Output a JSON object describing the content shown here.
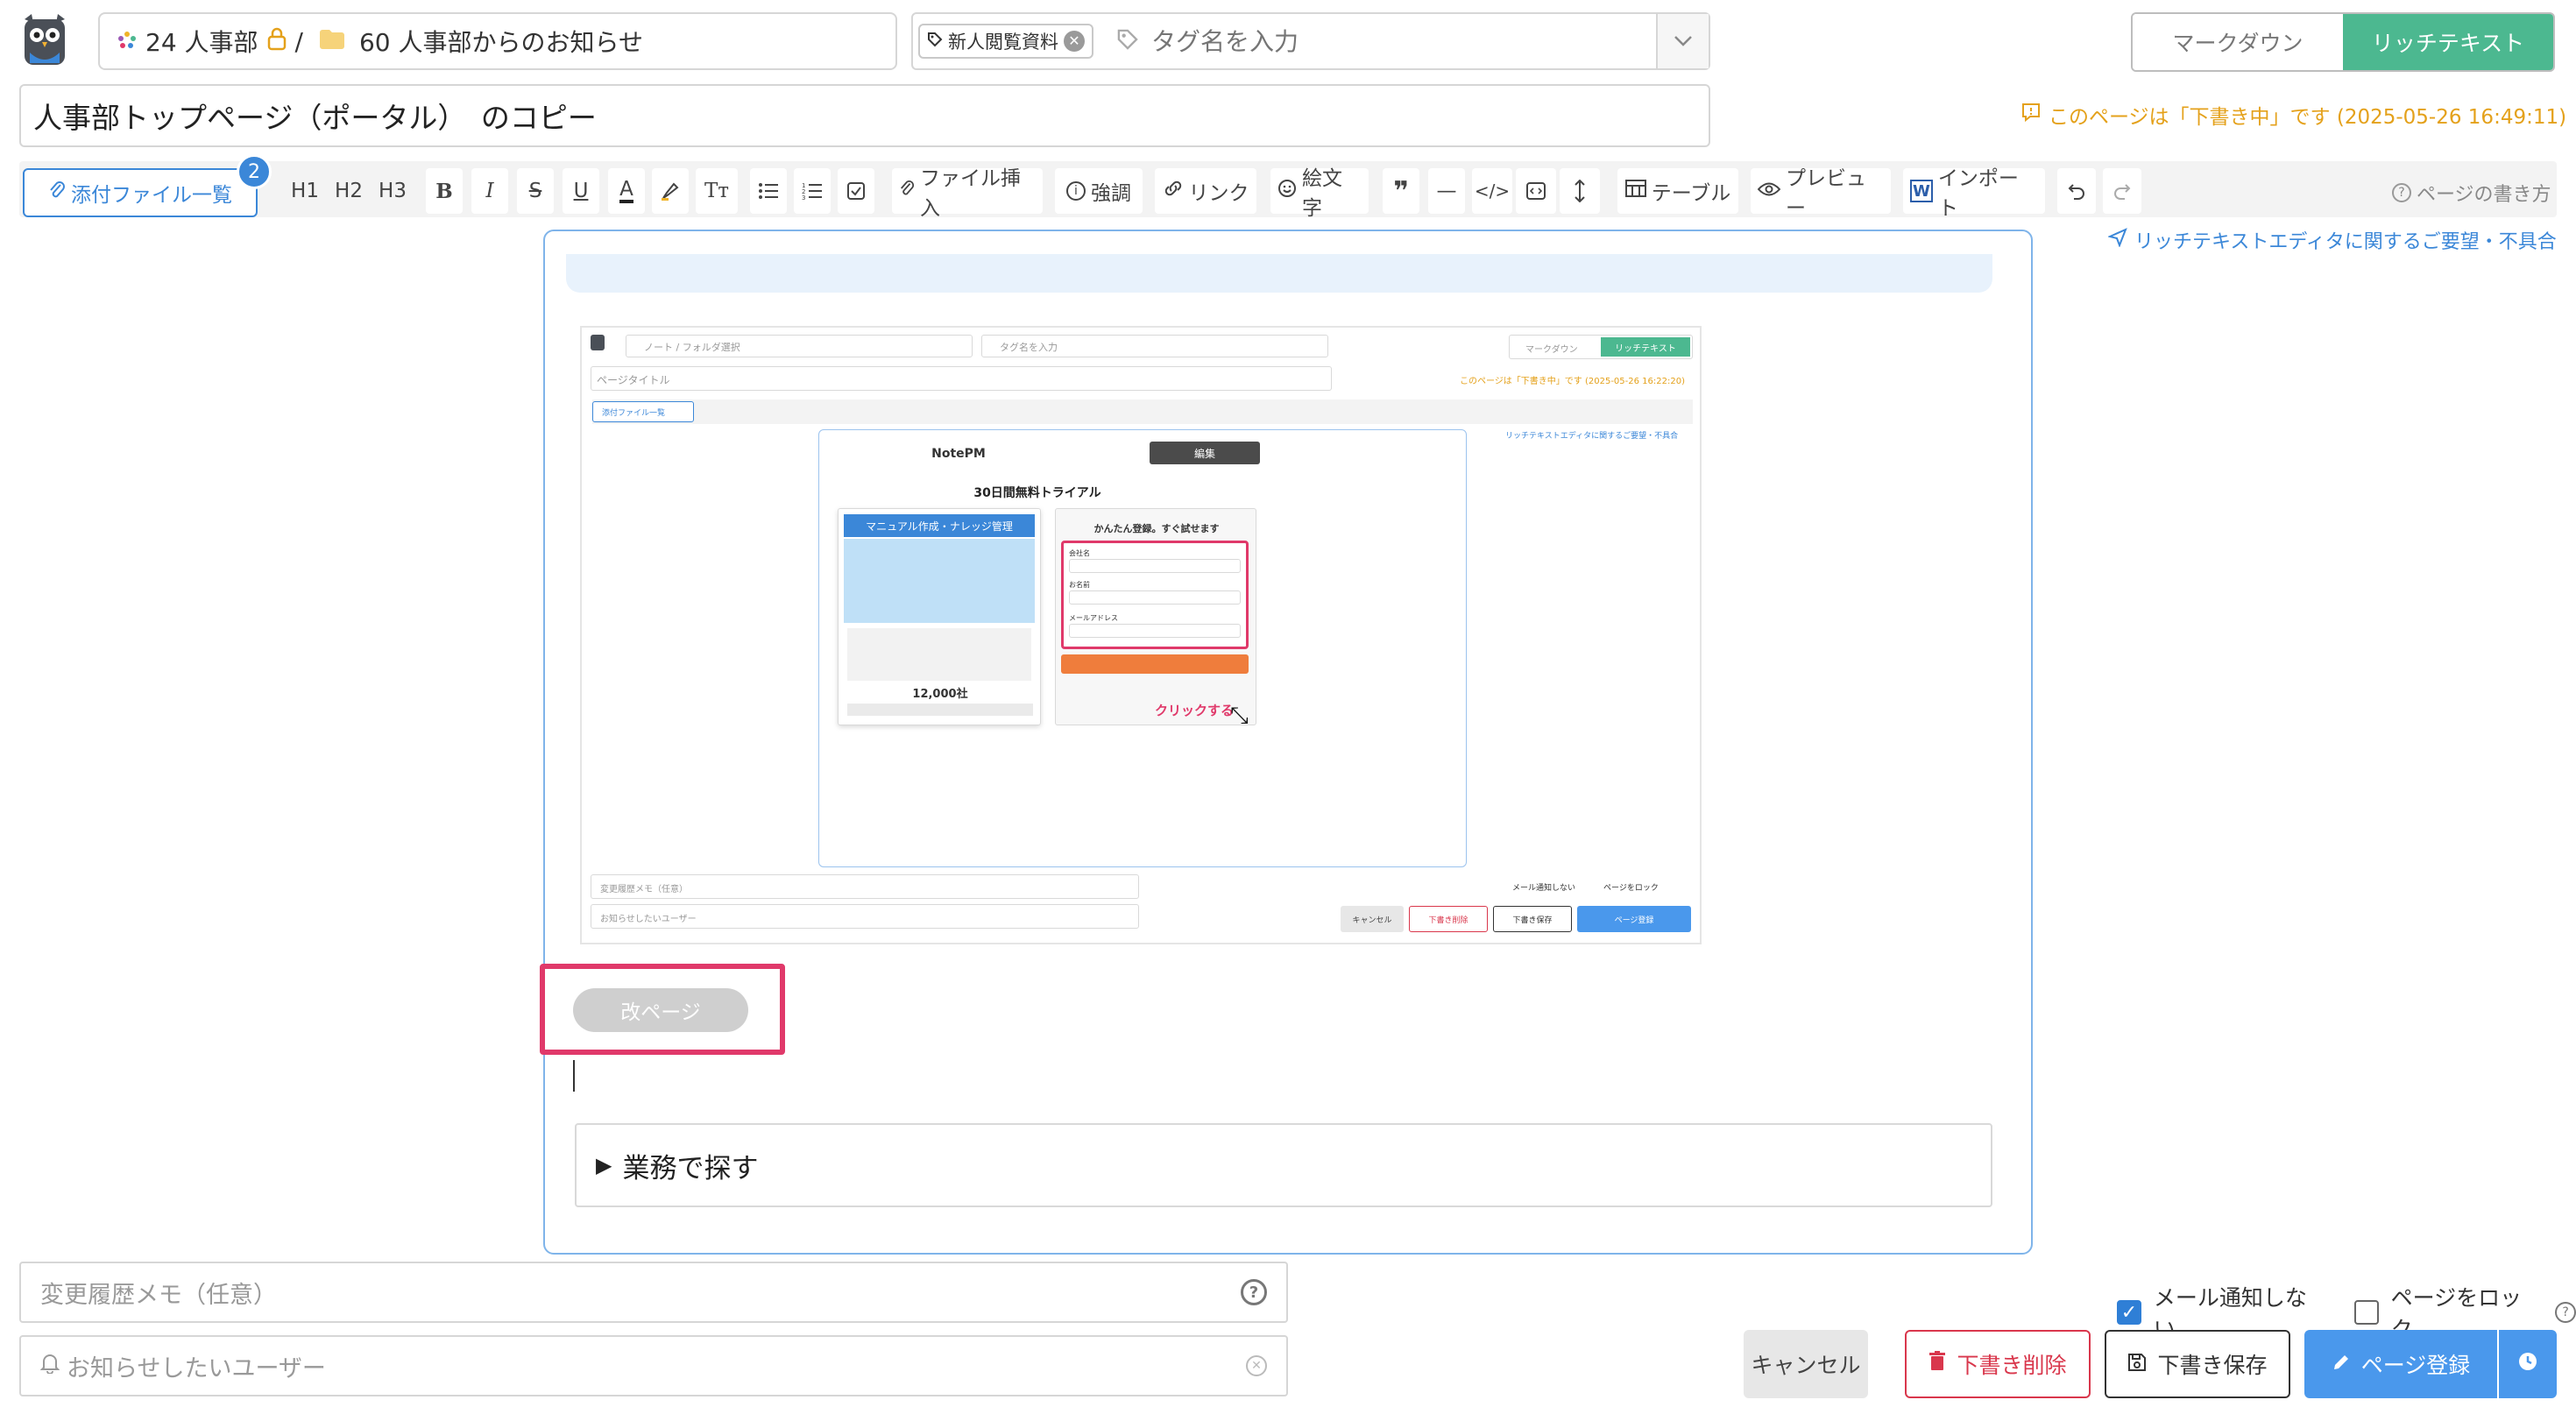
{
  "header": {
    "breadcrumb_space": "24 人事部",
    "breadcrumb_sep": "/",
    "breadcrumb_folder": "60 人事部からのお知らせ",
    "tag_chip": "新人閲覧資料",
    "tag_placeholder": "タグ名を入力",
    "mode_markdown": "マークダウン",
    "mode_richtext": "リッチテキスト"
  },
  "title": "人事部トップページ（ポータル）　のコピー",
  "draft_note": "このページは「下書き中」です (2025-05-26 16:49:11)",
  "toolbar": {
    "attach_label": "添付ファイル一覧",
    "attach_count": "2",
    "h1": "H1",
    "h2": "H2",
    "h3": "H3",
    "file_insert": "ファイル挿入",
    "emphasis": "強調",
    "link": "リンク",
    "emoji": "絵文字",
    "table": "テーブル",
    "preview": "プレビュー",
    "import": "インポート",
    "help": "ページの書き方"
  },
  "feedback_link": "リッチテキストエディタに関するご要望・不具合",
  "embedded": {
    "folder_placeholder": "ノート / フォルダ選択",
    "tag_placeholder": "タグ名を入力",
    "mode_markdown": "マークダウン",
    "mode_richtext": "リッチテキスト",
    "title_placeholder": "ページタイトル",
    "draft_note": "このページは「下書き中」です (2025-05-26 16:22:20)",
    "attach_label": "添付ファイル一覧",
    "feedback": "リッチテキストエディタに関するご要望・不具合",
    "edit_label": "編集",
    "brand": "NotePM",
    "trial_title": "30日間無料トライアル",
    "banner": "マニュアル作成・ナレッジ管理",
    "companies": "12,000社",
    "signup_title": "かんたん登録。すぐ試せます",
    "field_company": "会社名",
    "field_name": "お名前",
    "field_email": "メールアドレス",
    "click_label": "クリックする",
    "memo_placeholder": "変更履歴メモ（任意）",
    "notify_placeholder": "お知らせしたいユーザー",
    "opt_no_mail": "メール通知しない",
    "opt_lock": "ページをロック",
    "btn_cancel": "キャンセル",
    "btn_delete": "下書き削除",
    "btn_save": "下書き保存",
    "btn_submit": "ページ登録"
  },
  "page_break": "改ページ",
  "details_summary": "業務で探す",
  "footer": {
    "memo_placeholder": "変更履歴メモ（任意）",
    "notify_placeholder": "お知らせしたいユーザー",
    "no_mail_label": "メール通知しない",
    "no_mail_checked": true,
    "lock_label": "ページをロック",
    "lock_checked": false,
    "cancel": "キャンセル",
    "delete_draft": "下書き削除",
    "save_draft": "下書き保存",
    "submit": "ページ登録"
  },
  "colors": {
    "accent_green": "#4cb890",
    "accent_blue": "#3b87d8",
    "draft_orange": "#e4a11b",
    "danger_red": "#d9374c",
    "highlight_pink": "#e0396a"
  }
}
